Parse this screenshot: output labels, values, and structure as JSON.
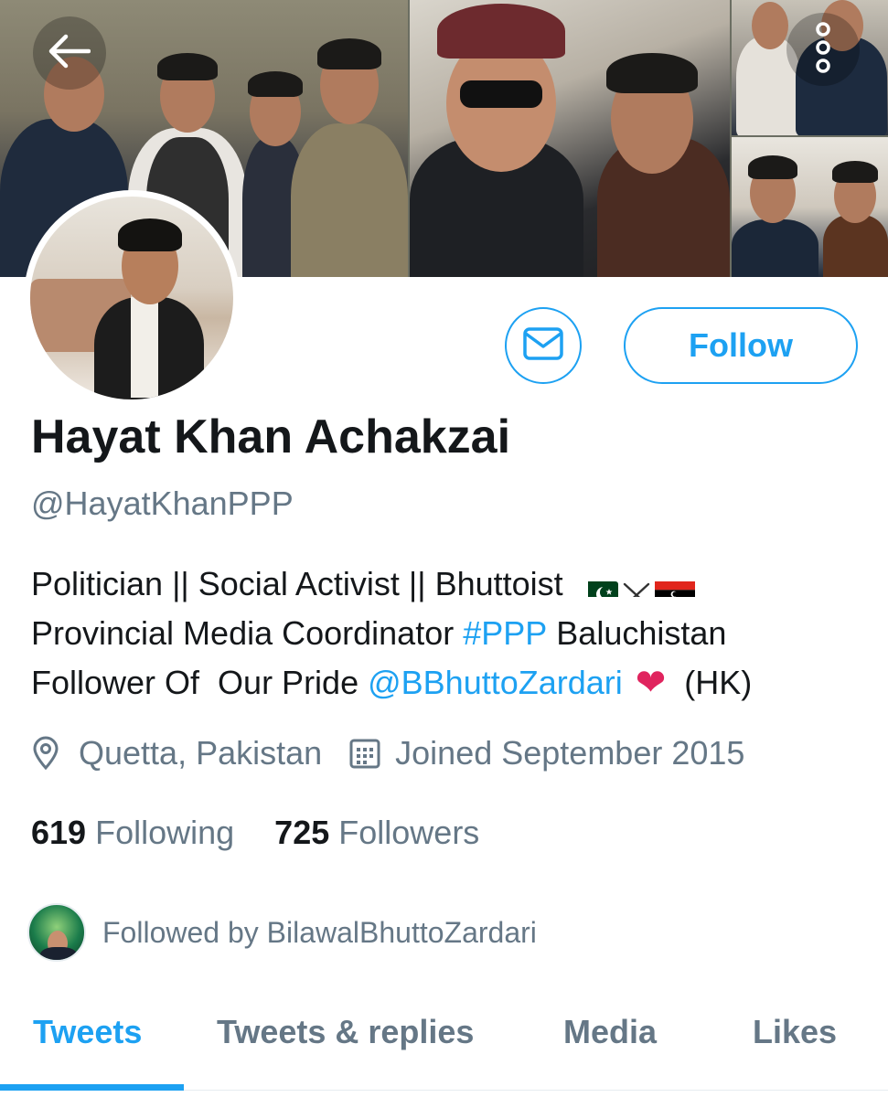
{
  "profile": {
    "name": "Hayat Khan Achakzai",
    "handle": "@HayatKhanPPP",
    "bio": {
      "line1_text": "Politician || Social Activist || Bhuttoist",
      "line2_prefix": "Provincial Media Coordinator ",
      "line2_hashtag": "#PPP",
      "line2_suffix": " Baluchistan",
      "line3_prefix": "Follower Of  Our Pride ",
      "line3_mention": "@BBhuttoZardari",
      "line3_suffix": "(HK)"
    },
    "location": "Quetta, Pakistan",
    "joined": "Joined September 2015"
  },
  "stats": {
    "following_count": "619",
    "following_label": "Following",
    "followers_count": "725",
    "followers_label": "Followers"
  },
  "followed_by": "Followed by BilawalBhuttoZardari",
  "actions": {
    "follow_label": "Follow"
  },
  "tabs": [
    {
      "label": "Tweets",
      "active": true
    },
    {
      "label": "Tweets & replies",
      "active": false
    },
    {
      "label": "Media",
      "active": false
    },
    {
      "label": "Likes",
      "active": false
    }
  ],
  "icons": {
    "back": "back-arrow-icon",
    "more": "more-vertical-icon",
    "message": "envelope-icon",
    "location": "location-pin-icon",
    "calendar": "calendar-icon",
    "heart": "red-heart-emoji",
    "flags": [
      "pakistan-flag-emoji",
      "crossed-swords-emoji",
      "ppp-flag-emoji"
    ]
  },
  "colors": {
    "accent": "#1da1f2",
    "secondary_text": "#657786",
    "primary_text": "#14171a"
  }
}
